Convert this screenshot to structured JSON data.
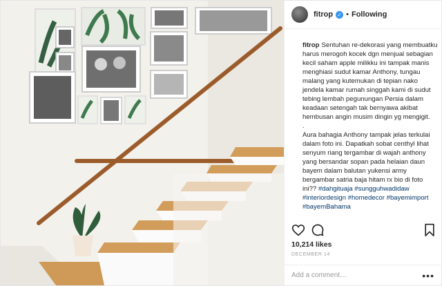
{
  "post": {
    "username": "fitrop",
    "verified_icon": "verified-badge-icon",
    "separator": "•",
    "follow_status": "Following",
    "caption_lines": [
      "Sentuhan re-dekorasi yang membuatku harus merogoh kocek dgn menjual sebagian kecil saham apple milikku ini tampak manis menghiasi sudut kamar Anthony, tungau malang yang kutemukan di tepian nako jendela kamar rumah singgah kami di sudut tebing lembah pegunungan Persia dalam keadaan setengah tak bernyawa akibat hembusan angin musim dingin yg mengigit.",
      ".",
      "Aura bahagia Anthony tampak jelas terkulai dalam foto ini. Dapatkah sobat centhyl lihat senyum riang tergambar di wajah anthony yang bersandar sopan pada helaian daun bayem dalam balutan yukensi army bergambar satria baja hitam rx bio di foto ini?? "
    ],
    "hashtags": [
      "#dahgituaja",
      "#sungguhwadidaw",
      "#interiordesign",
      "#homedecor",
      "#bayemimport",
      "#bayemBahama"
    ],
    "likes": "10,214 likes",
    "date": "DECEMBER 14",
    "comment_placeholder": "Add a comment…",
    "more_label": "•••"
  },
  "colors": {
    "link": "#003569",
    "verified": "#3897f0",
    "wall": "#f1efea",
    "wood": "#c98c4a",
    "handrail": "#8a4e24"
  },
  "icons": [
    "heart-icon",
    "comment-icon",
    "bookmark-icon",
    "more-options-icon"
  ]
}
